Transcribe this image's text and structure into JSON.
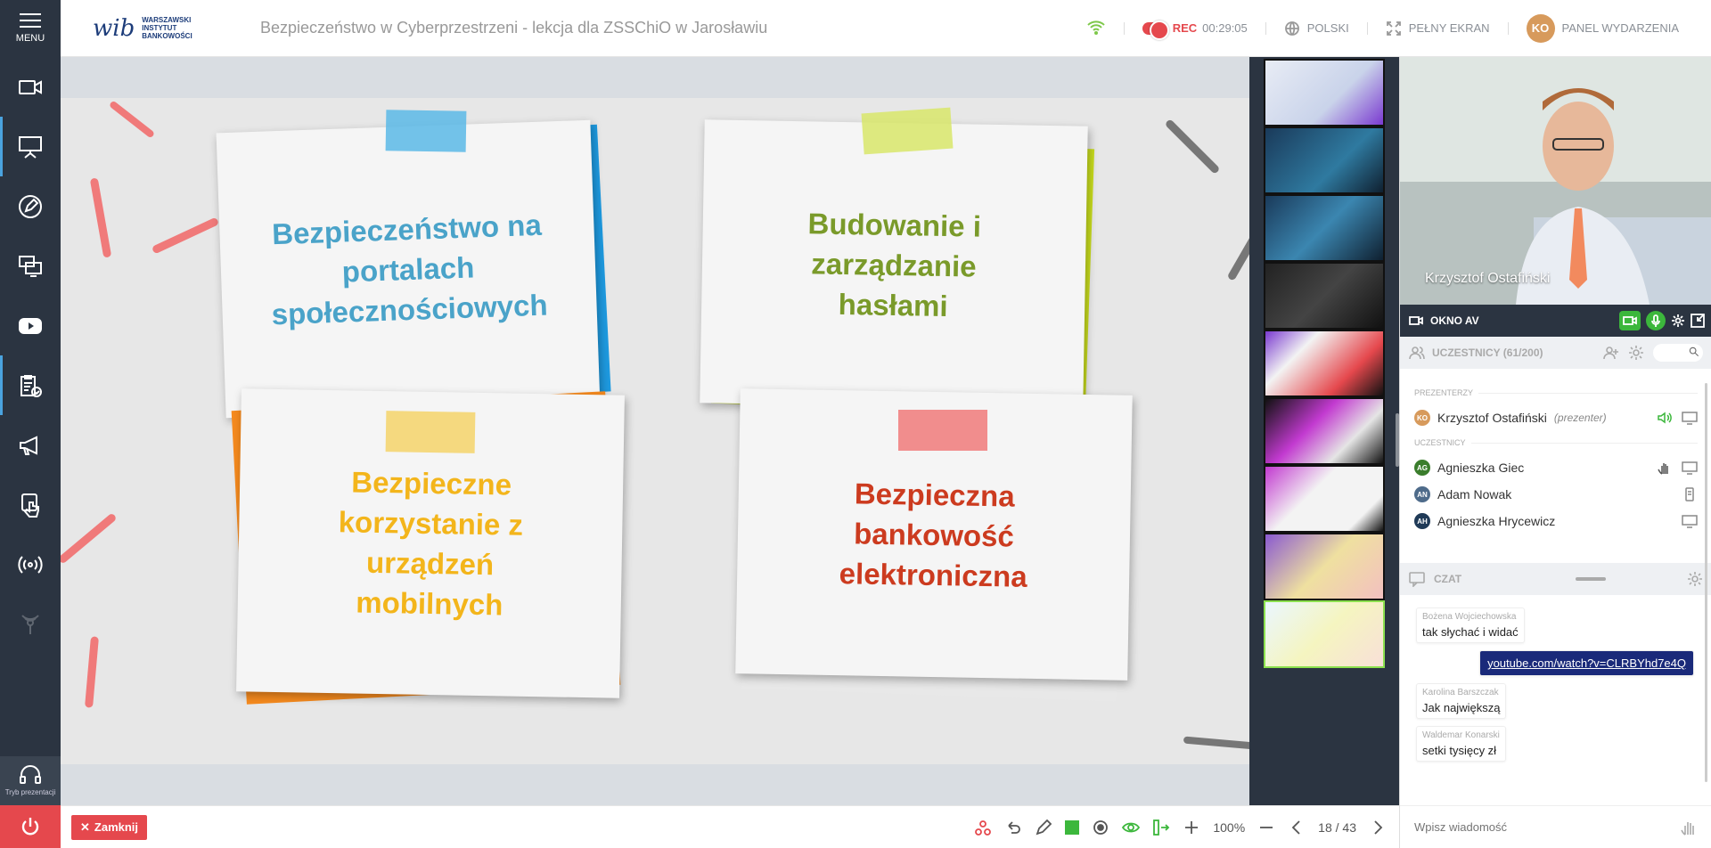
{
  "app": {
    "menu_label": "MENU",
    "mode_label": "Tryb prezentacji",
    "logo_text": "WARSZAWSKI INSTYTUT BANKOWOŚCI",
    "logo_mark": "wib",
    "title": "Bezpieczeństwo w Cyberprzestrzeni - lekcja dla ZSSChiO w Jarosławiu",
    "rec_label": "REC",
    "rec_time": "00:29:05",
    "language": "POLSKI",
    "fullscreen": "PEŁNY EKRAN",
    "panel_initials": "KO",
    "panel_label": "PANEL WYDARZENIA"
  },
  "colors": {
    "rail_bg": "#2b3441",
    "accent_red": "#e5484d",
    "accent_green": "#3cb73c",
    "blue_note": "#4aa3c9",
    "green_note": "#7a9a2a",
    "yellow_note": "#f3b51b",
    "red_note": "#cc3b1f"
  },
  "slide": {
    "note1": "Bezpieczeństwo na portalach społecznościowych",
    "note2": "Budowanie i zarządzanie hasłami",
    "note3": "Bezpieczne korzystanie z urządzeń mobilnych",
    "note4": "Bezpieczna bankowość elektroniczna"
  },
  "thumbnails": {
    "count_visible": 9,
    "active_index": 8
  },
  "video": {
    "name": "Krzysztof Ostafiński",
    "av_label": "OKNO AV"
  },
  "participants": {
    "header": "UCZESTNICY (61/200)",
    "presenters_label": "PREZENTERZY",
    "participants_label": "UCZESTNICY",
    "presenter": {
      "initials": "KO",
      "name": "Krzysztof Ostafiński",
      "role": "(prezenter)"
    },
    "list": [
      {
        "initials": "AG",
        "name": "Agnieszka Giec",
        "color": "#3a7d2c"
      },
      {
        "initials": "AN",
        "name": "Adam Nowak",
        "color": "#4e6b8a"
      },
      {
        "initials": "AH",
        "name": "Agnieszka Hrycewicz",
        "color": "#1f3a57"
      }
    ]
  },
  "chat": {
    "header": "CZAT",
    "messages": [
      {
        "author": "Bożena Wojciechowska",
        "text": "tak słychać i widać"
      },
      {
        "author": "",
        "text": "youtube.com/watch?v=CLRBYhd7e4Q"
      },
      {
        "author": "Karolina Barszczak",
        "text": "Jak największą"
      },
      {
        "author": "Waldemar Konarski",
        "text": "setki tysięcy zł"
      }
    ],
    "input_placeholder": "Wpisz wiadomość"
  },
  "toolbar": {
    "close_label": "Zamknij",
    "zoom": "100%",
    "page": "18 / 43"
  }
}
